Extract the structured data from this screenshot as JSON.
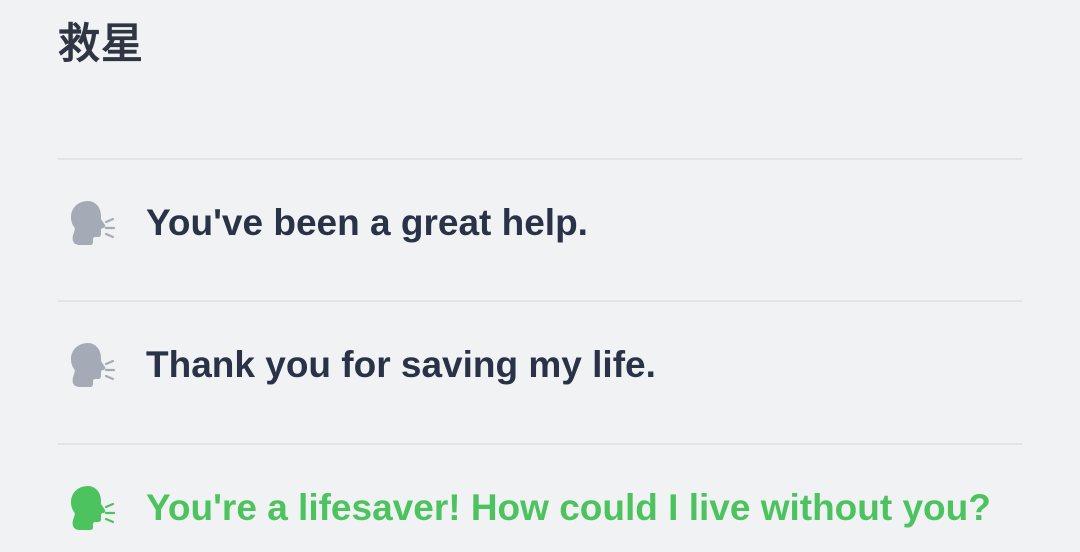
{
  "header": {
    "title": "救星"
  },
  "phrases": [
    {
      "text": "You've been a great help.",
      "icon": "speaking-head-icon",
      "icon_color": "#a5abb6",
      "active": false
    },
    {
      "text": "Thank you for saving my life.",
      "icon": "speaking-head-icon",
      "icon_color": "#a5abb6",
      "active": false
    },
    {
      "text": "You're a lifesaver! How could I live without you?",
      "icon": "speaking-head-icon",
      "icon_color": "#4cc35e",
      "active": true
    }
  ],
  "colors": {
    "background": "#f1f2f4",
    "text": "#2a3247",
    "accent": "#4cc35e",
    "icon_inactive": "#a5abb6",
    "divider": "#e2e4e8"
  }
}
